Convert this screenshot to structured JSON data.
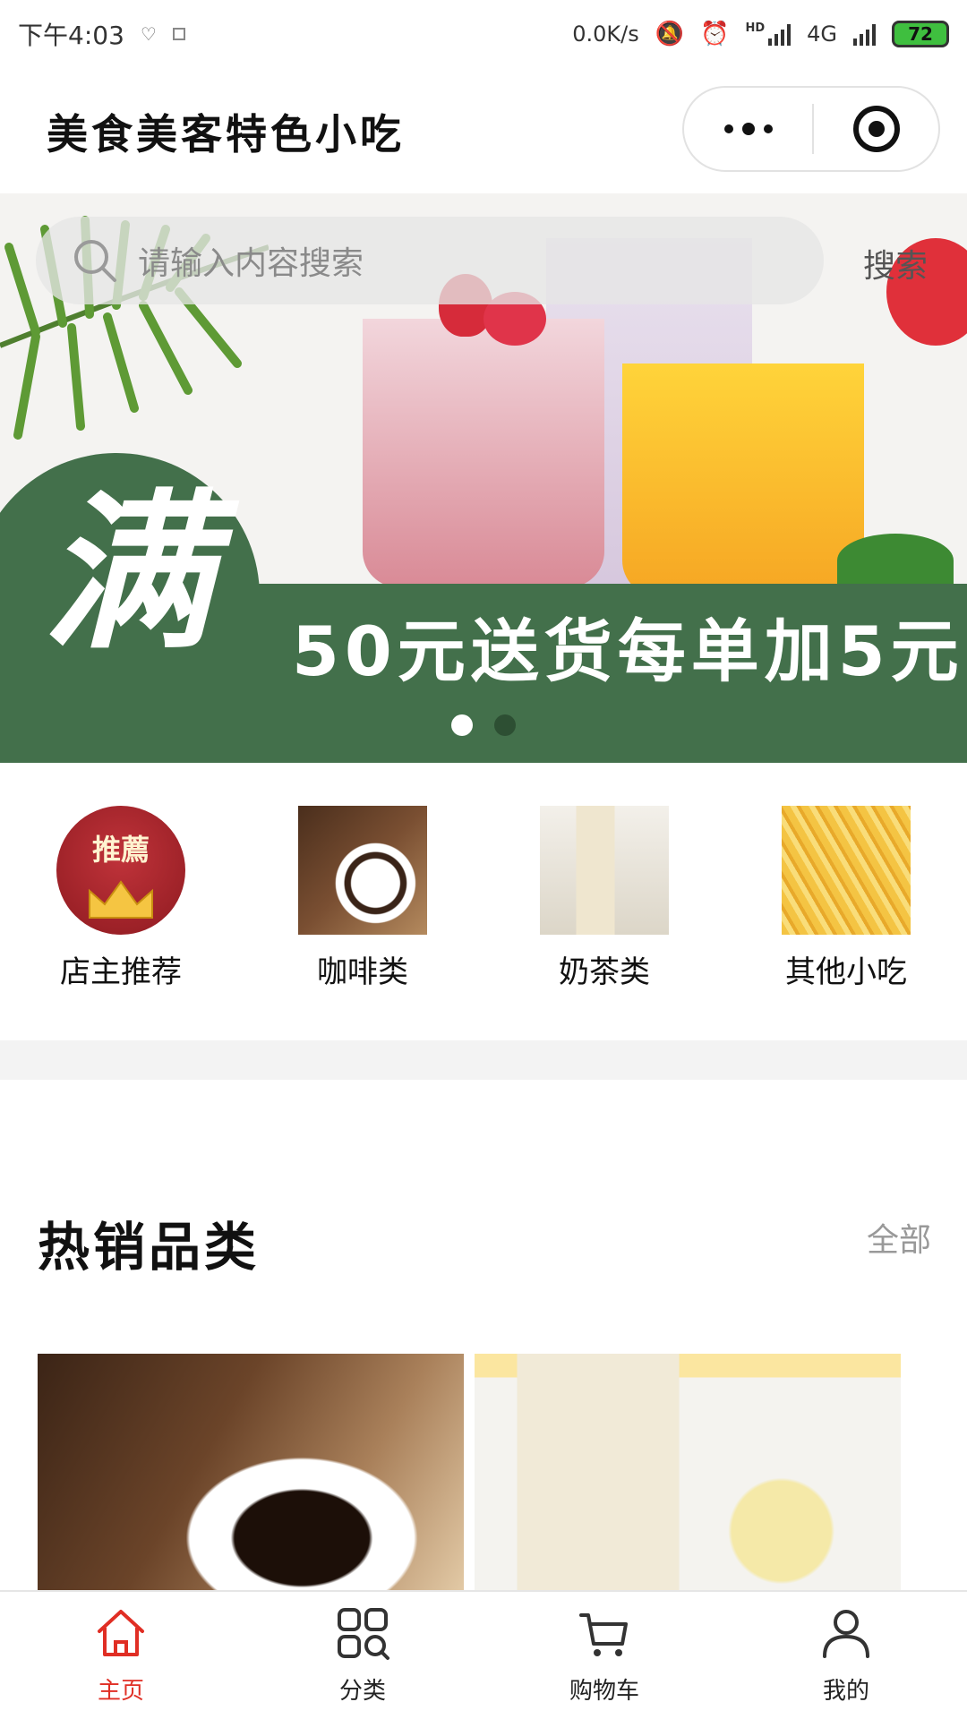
{
  "status_bar": {
    "time": "下午4:03",
    "network_speed": "0.0K/s",
    "network_type": "4G",
    "hd_label": "HD",
    "battery": "72"
  },
  "title_bar": {
    "title": "美食美客特色小吃"
  },
  "banner": {
    "search_placeholder": "请输入内容搜索",
    "search_button": "搜索",
    "promo_big": "满",
    "promo_text": "50元送货每单加5元",
    "slide_count": 2,
    "active_slide": 1,
    "band_color": "#43704b"
  },
  "categories": [
    {
      "label": "店主推荐",
      "badge": "推薦",
      "icon": "crown-badge-image"
    },
    {
      "label": "咖啡类",
      "icon": "coffee-image"
    },
    {
      "label": "奶茶类",
      "icon": "milk-tea-image"
    },
    {
      "label": "其他小吃",
      "icon": "fries-image"
    }
  ],
  "section": {
    "title": "热销品类",
    "all_link": "全部"
  },
  "products": [
    {
      "icon": "coffee-beans-cup-image"
    },
    {
      "icon": "banana-milkshake-image"
    }
  ],
  "tab_bar": {
    "accent_color": "#e02e24",
    "tabs": [
      {
        "label": "主页",
        "icon": "home-icon",
        "active": true
      },
      {
        "label": "分类",
        "icon": "grid-icon",
        "active": false
      },
      {
        "label": "购物车",
        "icon": "cart-icon",
        "active": false
      },
      {
        "label": "我的",
        "icon": "user-icon",
        "active": false
      }
    ]
  }
}
